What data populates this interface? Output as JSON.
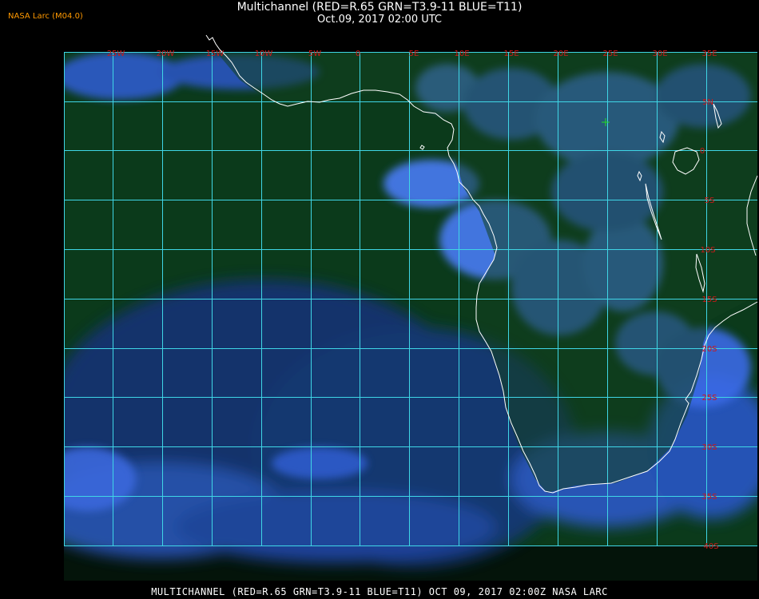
{
  "header": {
    "title": "Multichannel (RED=R.65 GRN=T3.9-11 BLUE=T11)",
    "subtitle": "Oct.09, 2017 02:00 UTC",
    "credit": "NASA Larc (M04.0)"
  },
  "footer": {
    "caption": "MULTICHANNEL (RED=R.65 GRN=T3.9-11 BLUE=T11) OCT 09, 2017 02:00Z  NASA LARC"
  },
  "colors": {
    "ocean": "#0d3b1c",
    "cloud_dark": "#1f3fa8",
    "cloud_bright": "#4f86ff",
    "grid": "#3fd6e6",
    "coast": "#ffffff",
    "label": "#d01818"
  },
  "map": {
    "lon_labels": [
      "25W",
      "20W",
      "15W",
      "10W",
      "5W",
      "0",
      "5E",
      "10E",
      "15E",
      "20E",
      "25E",
      "30E",
      "35E"
    ],
    "lat_labels": [
      "5N",
      "0",
      "5S",
      "10S",
      "15S",
      "20S",
      "25S",
      "30S",
      "35S",
      "40S"
    ]
  }
}
